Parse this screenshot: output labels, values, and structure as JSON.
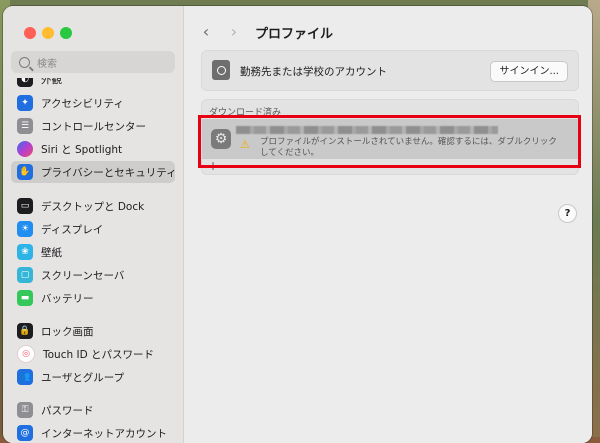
{
  "sidebar": {
    "search_placeholder": "検索",
    "items": [
      {
        "label": "外観",
        "icon": "appearance-icon",
        "color": "#1d1d1f"
      },
      {
        "label": "アクセシビリティ",
        "icon": "accessibility-icon",
        "color": "#1f6fe0"
      },
      {
        "label": "コントロールセンター",
        "icon": "control-center-icon",
        "color": "#8e8e93"
      },
      {
        "label": "Siri と Spotlight",
        "icon": "siri-icon",
        "color": "#7b3fd0"
      },
      {
        "label": "プライバシーとセキュリティ",
        "icon": "hand-icon",
        "color": "#1f6fe0"
      },
      {
        "label": "デスクトップと Dock",
        "icon": "desktop-icon",
        "color": "#1d1d1f"
      },
      {
        "label": "ディスプレイ",
        "icon": "display-icon",
        "color": "#1f8ef0"
      },
      {
        "label": "壁紙",
        "icon": "wallpaper-icon",
        "color": "#2db3e5"
      },
      {
        "label": "スクリーンセーバ",
        "icon": "screensaver-icon",
        "color": "#35b6d8"
      },
      {
        "label": "バッテリー",
        "icon": "battery-icon",
        "color": "#34c759"
      },
      {
        "label": "ロック画面",
        "icon": "lock-icon",
        "color": "#1d1d1f"
      },
      {
        "label": "Touch ID とパスワード",
        "icon": "fingerprint-icon",
        "color": "#ff5a6e"
      },
      {
        "label": "ユーザとグループ",
        "icon": "users-icon",
        "color": "#1f6fe0"
      },
      {
        "label": "パスワード",
        "icon": "key-icon",
        "color": "#8e8e93"
      },
      {
        "label": "インターネットアカウント",
        "icon": "at-icon",
        "color": "#1f6fe0"
      }
    ]
  },
  "toolbar": {
    "back_icon": "‹",
    "forward_icon": "›",
    "title": "プロファイル"
  },
  "account": {
    "label": "勤務先または学校のアカウント",
    "signin_label": "サインイン..."
  },
  "downloaded": {
    "header": "ダウンロード済み",
    "warning_text": "プロファイルがインストールされていません。確認するには、ダブルクリックしてください。",
    "add_label": "+",
    "remove_label": "−"
  },
  "help": {
    "label": "?"
  }
}
